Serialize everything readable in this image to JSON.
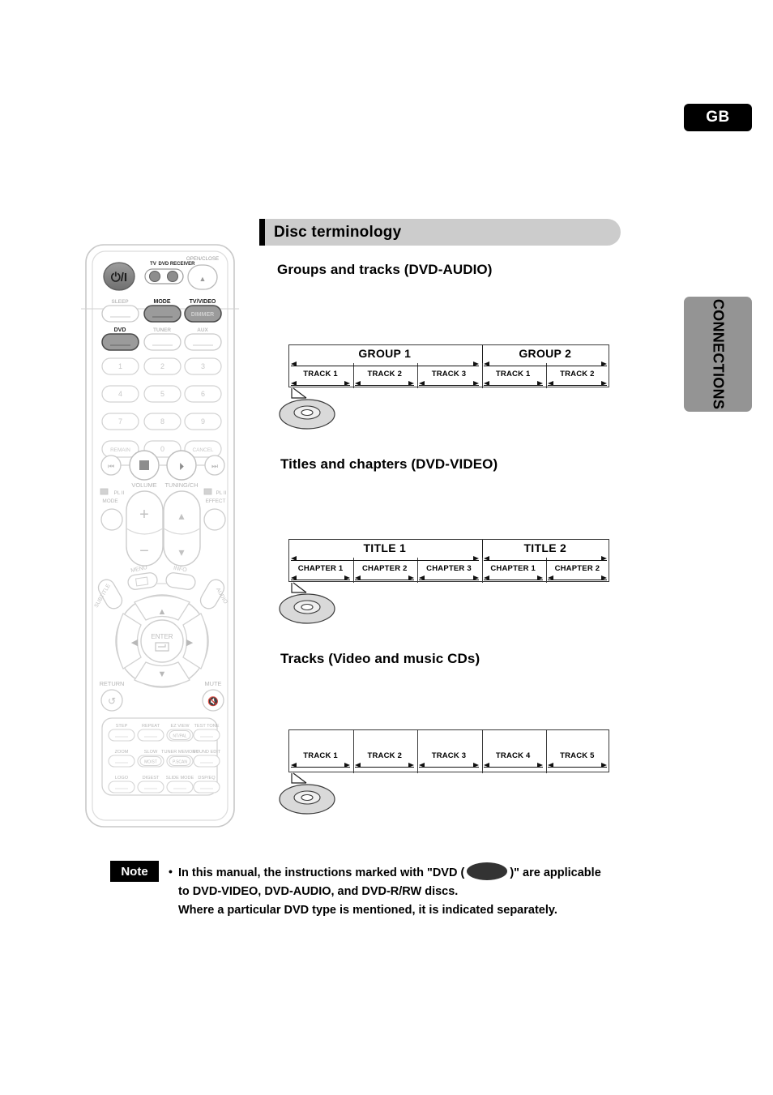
{
  "page": {
    "locale_badge": "GB",
    "side_tab": "CONNECTIONS",
    "section_title": "Disc terminology"
  },
  "sections": [
    {
      "heading": "Groups and tracks (DVD-AUDIO)"
    },
    {
      "heading": "Titles and chapters (DVD-VIDEO)"
    },
    {
      "heading": "Tracks (Video and music CDs)"
    }
  ],
  "diagrams": [
    {
      "name": "groups-and-tracks",
      "top_row": [
        {
          "label": "GROUP 1",
          "span": 3
        },
        {
          "label": "GROUP 2",
          "span": 2
        }
      ],
      "bottom_row": [
        "TRACK 1",
        "TRACK 2",
        "TRACK 3",
        "TRACK 1",
        "TRACK 2"
      ]
    },
    {
      "name": "titles-and-chapters",
      "top_row": [
        {
          "label": "TITLE 1",
          "span": 3
        },
        {
          "label": "TITLE 2",
          "span": 2
        }
      ],
      "bottom_row": [
        "CHAPTER 1",
        "CHAPTER 2",
        "CHAPTER 3",
        "CHAPTER 1",
        "CHAPTER 2"
      ]
    },
    {
      "name": "tracks-cd",
      "top_row": [],
      "bottom_row": [
        "TRACK 1",
        "TRACK 2",
        "TRACK 3",
        "TRACK 4",
        "TRACK 5"
      ]
    }
  ],
  "note": {
    "badge": "Note",
    "bullet": "•",
    "line1_before": "In this manual, the instructions marked with \"DVD (",
    "line1_after": ")\" are applicable",
    "line2": "to DVD-VIDEO, DVD-AUDIO, and DVD-R/RW discs.",
    "line3": "Where a particular DVD type is mentioned, it is indicated separately."
  },
  "remote": {
    "labels": {
      "open_close": "OPEN/CLOSE",
      "tv": "TV",
      "dvd_receiver": "DVD RECEIVER",
      "sleep": "SLEEP",
      "mode": "MODE",
      "tv_video": "TV/VIDEO",
      "dimmer": "DIMMER",
      "dvd": "DVD",
      "tuner": "TUNER",
      "aux": "AUX",
      "remain": "REMAIN",
      "cancel": "CANCEL",
      "volume": "VOLUME",
      "tuning_ch": "TUNING/CH",
      "pl2_mode_top": "PL II",
      "pl2_mode": "MODE",
      "pl2_effect_top": "PL II",
      "pl2_effect": "EFFECT",
      "menu": "MENU",
      "info": "INFO",
      "subtitle": "SUBTITLE",
      "audio": "AUDIO",
      "enter": "ENTER",
      "return": "RETURN",
      "mute": "MUTE",
      "step": "STEP",
      "repeat": "REPEAT",
      "ez_view": "EZ VIEW",
      "nt_pal": "NT/PAL",
      "test_tone": "TEST TONE",
      "zoom": "ZOOM",
      "slow": "SLOW",
      "most": "MO/ST",
      "tuner_memory": "TUNER MEMORY",
      "p_scan": "P.SCAN",
      "sound_edit": "SOUND EDIT",
      "logo": "LOGO",
      "digest": "DIGEST",
      "slide_mode": "SLIDE MODE",
      "dsp_eq": "DSP/EQ"
    },
    "keypad": [
      "1",
      "2",
      "3",
      "4",
      "5",
      "6",
      "7",
      "8",
      "9",
      "0"
    ]
  }
}
